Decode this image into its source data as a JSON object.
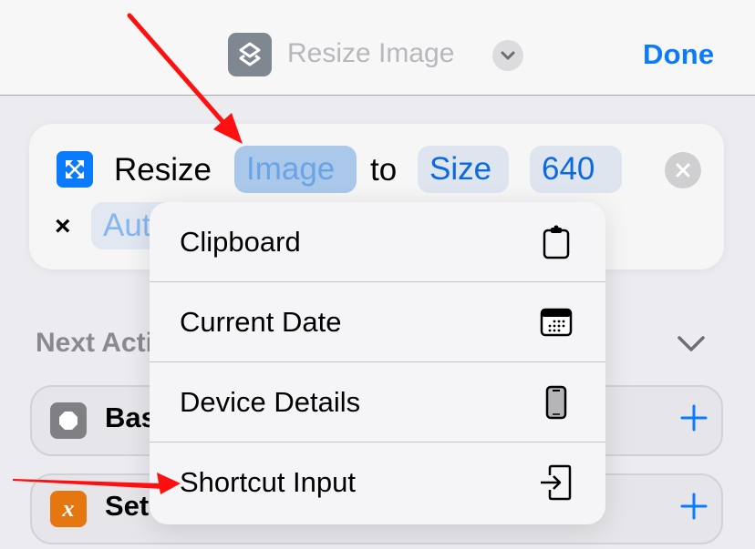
{
  "nav": {
    "title": "Resize Image",
    "app_icon": "shortcuts-icon",
    "done_label": "Done"
  },
  "action": {
    "icon": "resize-arrows-icon",
    "verb": "Resize",
    "input_token": "Image",
    "connector": "to",
    "mode_token": "Size",
    "width_token": "640",
    "times_symbol": "×",
    "height_token": "Auto",
    "accent_color": "#0a7aff"
  },
  "next_actions": {
    "label": "Next Action Suggestions",
    "visible_label": "Next Ac",
    "items": [
      {
        "label": "Basic",
        "visible_label": "Bas",
        "icon": "stop-octagon-icon",
        "icon_color": "#7f7f84"
      },
      {
        "label": "Set Variable",
        "visible_label": "Set",
        "icon": "variable-x-icon",
        "icon_color": "#e6760f"
      }
    ]
  },
  "variable_menu": {
    "items": [
      {
        "label": "Clipboard",
        "icon": "clipboard-icon"
      },
      {
        "label": "Current Date",
        "icon": "calendar-icon"
      },
      {
        "label": "Device Details",
        "icon": "iphone-icon"
      },
      {
        "label": "Shortcut Input",
        "icon": "shortcut-input-icon"
      }
    ]
  },
  "annotations": {
    "arrow_color": "#ff1010"
  }
}
